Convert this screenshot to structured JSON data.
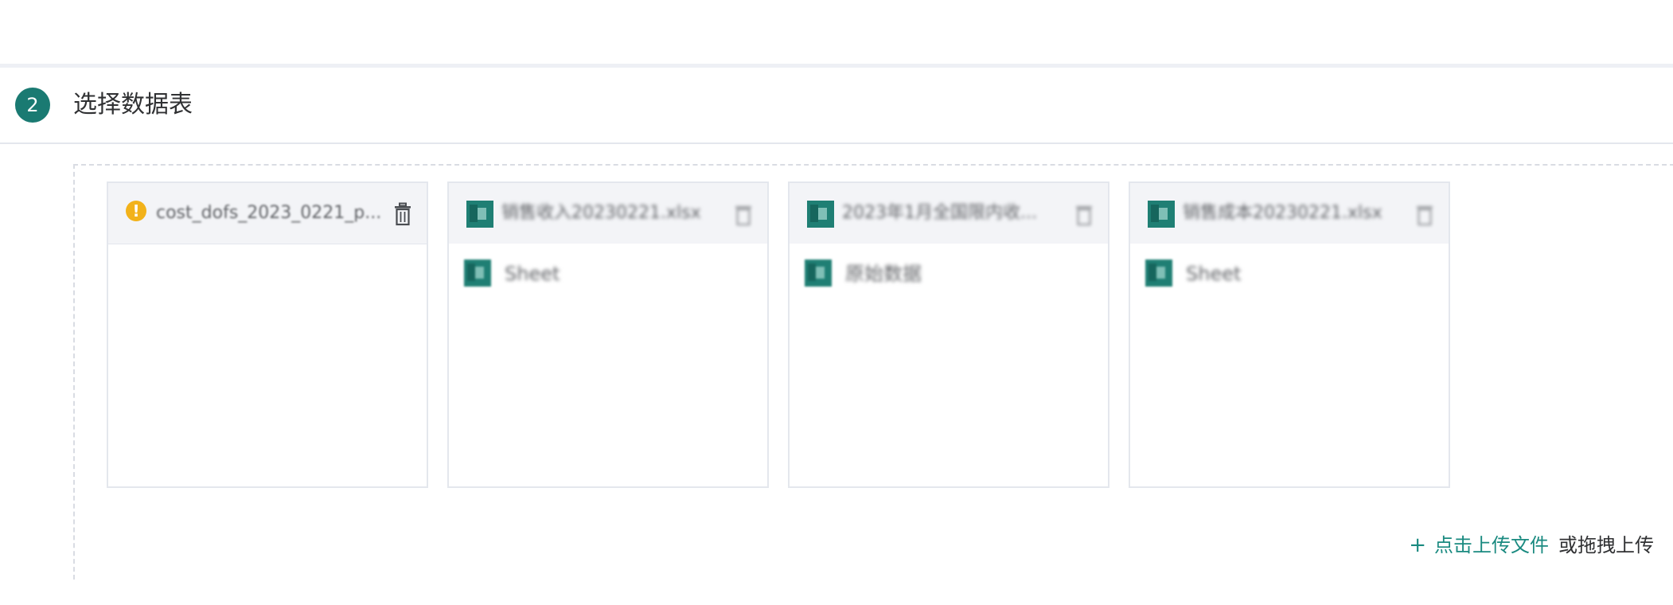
{
  "section": {
    "step_number": "2",
    "title": "选择数据表"
  },
  "cards": [
    {
      "file_name": "cost_dofs_2023_0221_p...",
      "status_icon": "warning-icon",
      "sheets": []
    },
    {
      "file_name": "销售收入20230221.xlsx",
      "status_icon": "excel-file-icon",
      "sheets": [
        "Sheet"
      ]
    },
    {
      "file_name": "2023年1月全国限内收...",
      "status_icon": "excel-file-icon",
      "sheets": [
        "原始数据"
      ]
    },
    {
      "file_name": "销售成本20230221.xlsx",
      "status_icon": "excel-file-icon",
      "sheets": [
        "Sheet"
      ]
    }
  ],
  "upload": {
    "plus": "+",
    "link_label": "点击上传文件",
    "hint": "或拖拽上传"
  },
  "colors": {
    "accent": "#1a7a72",
    "link": "#1a8a80",
    "warning": "#f2b21a",
    "card_header_bg": "#f3f4f7",
    "border": "#e4e7ed"
  }
}
